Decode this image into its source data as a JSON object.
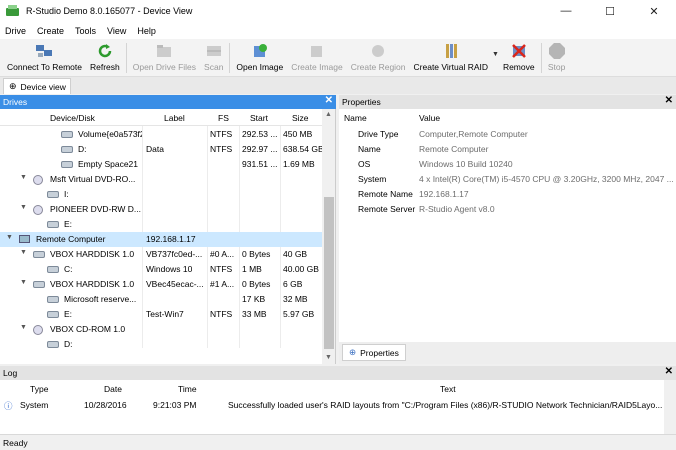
{
  "window": {
    "title": "R-Studio Demo 8.0.165077 - Device View",
    "controls": {
      "minimize": "—",
      "maximize": "☐",
      "close": "✕"
    }
  },
  "menu": [
    "Drive",
    "Create",
    "Tools",
    "View",
    "Help"
  ],
  "toolbar": [
    {
      "label": "Connect To Remote",
      "icon": "network-computers-icon",
      "enabled": true
    },
    {
      "label": "Refresh",
      "icon": "refresh-icon",
      "enabled": true
    },
    {
      "label": "Open Drive Files",
      "icon": "folder-icon",
      "enabled": false
    },
    {
      "label": "Scan",
      "icon": "scan-icon",
      "enabled": false
    },
    {
      "label": "Open Image",
      "icon": "open-image-icon",
      "enabled": true
    },
    {
      "label": "Create Image",
      "icon": "create-image-icon",
      "enabled": false
    },
    {
      "label": "Create Region",
      "icon": "create-region-icon",
      "enabled": false
    },
    {
      "label": "Create Virtual RAID",
      "icon": "raid-icon",
      "enabled": true
    },
    {
      "label": "Remove",
      "icon": "remove-icon",
      "enabled": true
    },
    {
      "label": "Stop",
      "icon": "stop-icon",
      "enabled": false
    }
  ],
  "doc_tab": "Device view",
  "drives": {
    "title": "Drives",
    "columns": [
      "Device/Disk",
      "Label",
      "FS",
      "Start",
      "Size"
    ],
    "rows": [
      {
        "name": "Volume{e0a573f2...",
        "label": "",
        "fs": "NTFS",
        "start": "292.53 ...",
        "size": "450 MB",
        "icon": "volume-icon"
      },
      {
        "name": "D:",
        "label": "Data",
        "fs": "NTFS",
        "start": "292.97 ...",
        "size": "638.54 GB",
        "icon": "volume-icon"
      },
      {
        "name": "Empty Space21",
        "label": "",
        "fs": "",
        "start": "931.51 ...",
        "size": "1.69 MB",
        "icon": "empty-space-icon"
      },
      {
        "name": "Msft Virtual DVD-RO...",
        "label": "",
        "fs": "",
        "start": "",
        "size": "",
        "icon": "cd-drive-icon"
      },
      {
        "name": "I:",
        "label": "",
        "fs": "",
        "start": "",
        "size": "",
        "icon": "volume-icon"
      },
      {
        "name": "PIONEER DVD-RW D...",
        "label": "",
        "fs": "",
        "start": "",
        "size": "",
        "icon": "cd-drive-icon"
      },
      {
        "name": "E:",
        "label": "",
        "fs": "",
        "start": "",
        "size": "",
        "icon": "volume-icon"
      },
      {
        "name": "Remote Computer",
        "label": "192.168.1.17",
        "fs": "",
        "start": "",
        "size": "",
        "icon": "computer-icon"
      },
      {
        "name": "VBOX HARDDISK 1.0",
        "label": "VB737fc0ed-...",
        "fs": "#0 A...",
        "start": "0 Bytes",
        "size": "40 GB",
        "icon": "hard-disk-icon"
      },
      {
        "name": "C:",
        "label": "Windows 10",
        "fs": "NTFS",
        "start": "1 MB",
        "size": "40.00 GB",
        "icon": "volume-icon"
      },
      {
        "name": "VBOX HARDDISK 1.0",
        "label": "VBec45ecac-...",
        "fs": "#1 A...",
        "start": "0 Bytes",
        "size": "6 GB",
        "icon": "hard-disk-icon"
      },
      {
        "name": "Microsoft reserve...",
        "label": "",
        "fs": "",
        "start": "17 KB",
        "size": "32 MB",
        "icon": "volume-icon"
      },
      {
        "name": "E:",
        "label": "Test-Win7",
        "fs": "NTFS",
        "start": "33 MB",
        "size": "5.97 GB",
        "icon": "volume-icon"
      },
      {
        "name": "VBOX CD-ROM 1.0",
        "label": "",
        "fs": "",
        "start": "",
        "size": "",
        "icon": "cd-drive-icon"
      },
      {
        "name": "D:",
        "label": "",
        "fs": "",
        "start": "",
        "size": "",
        "icon": "volume-icon"
      }
    ]
  },
  "properties": {
    "title": "Properties",
    "columns": [
      "Name",
      "Value"
    ],
    "rows": [
      {
        "name": "Drive Type",
        "value": "Computer,Remote Computer"
      },
      {
        "name": "Name",
        "value": "Remote Computer"
      },
      {
        "name": "OS",
        "value": "Windows 10 Build 10240"
      },
      {
        "name": "System",
        "value": "4 x Intel(R) Core(TM) i5-4570 CPU @ 3.20GHz, 3200 MHz, 2047 ..."
      },
      {
        "name": "Remote Name",
        "value": "192.168.1.17"
      },
      {
        "name": "Remote Server",
        "value": "R-Studio Agent v8.0"
      }
    ],
    "tab": "Properties"
  },
  "log": {
    "title": "Log",
    "columns": [
      "Type",
      "Date",
      "Time",
      "Text"
    ],
    "rows": [
      {
        "type": "System",
        "date": "10/28/2016",
        "time": "9:21:03 PM",
        "text": "Successfully loaded user's RAID layouts from \"C:/Program Files (x86)/R-STUDIO Network Technician/RAID5Layo..."
      }
    ]
  },
  "status": "Ready"
}
